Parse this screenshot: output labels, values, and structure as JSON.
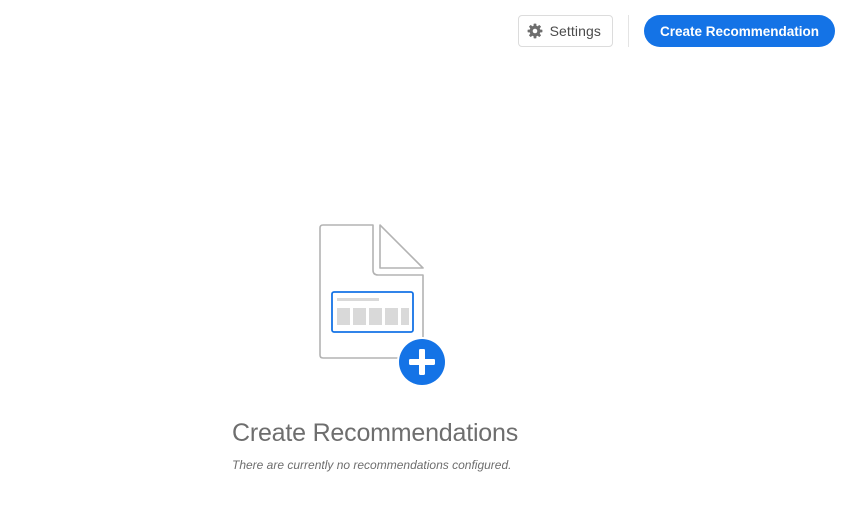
{
  "toolbar": {
    "settings_label": "Settings",
    "settings_icon": "gear-icon",
    "create_label": "Create Recommendation"
  },
  "empty_state": {
    "illustration_icon": "document-add-icon",
    "title": "Create Recommendations",
    "subtitle": "There are currently no recommendations configured."
  },
  "colors": {
    "accent": "#1473e6",
    "icon_gray": "#6e6e6e",
    "illustration_stroke": "#b3b3b3",
    "illustration_fill": "#d9d9d9"
  }
}
